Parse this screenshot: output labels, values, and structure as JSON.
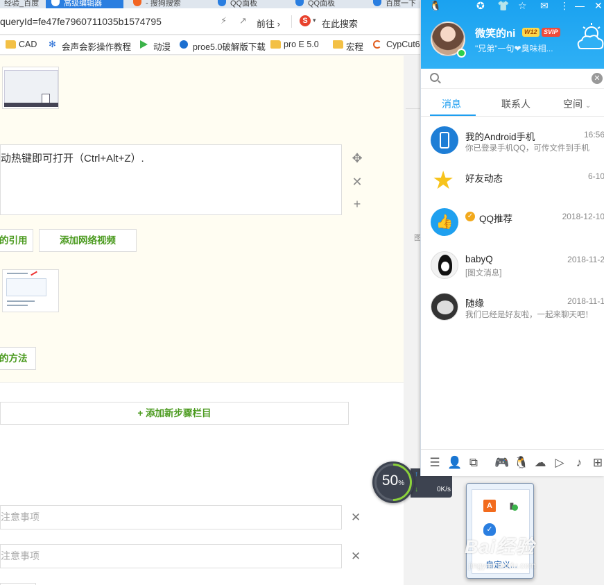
{
  "browser": {
    "tabs": [
      {
        "label": "经验_百度"
      },
      {
        "label": "高级编辑器"
      },
      {
        "label": "- 搜狗搜索"
      },
      {
        "label": "QQ面板"
      },
      {
        "label": "QQ面板"
      },
      {
        "label": "百度一下"
      }
    ],
    "url": "queryId=fe47fe7960711035b1574795",
    "go_label": "前往",
    "search_label": "在此搜索",
    "bookmarks": [
      {
        "label": "CAD"
      },
      {
        "label": "会声会影操作教程"
      },
      {
        "label": "动漫"
      },
      {
        "label": "proe5.0破解版下载"
      },
      {
        "label": "pro E 5.0"
      },
      {
        "label": "宏程"
      },
      {
        "label": "CypCut6"
      }
    ]
  },
  "editor": {
    "step_text": "动热键即可打开（Ctrl+Alt+Z）.",
    "btn_link": "的引用",
    "btn_video": "添加网络视频",
    "btn_method": "的方法",
    "add_step": "+ 添加新步骤栏目",
    "note_placeholder_1": "注意事项",
    "note_placeholder_2": "注意事项",
    "gutter_char": "图"
  },
  "speed": {
    "percent": "50",
    "percent_unit": "%",
    "up": "0K/s",
    "down": "0K/s"
  },
  "tray": {
    "customize": "自定义..."
  },
  "watermark": {
    "brand": "Bai经验",
    "url": "jingyan.baidu.com"
  },
  "qq": {
    "nickname": "微笑的ni",
    "level_badge": "W12",
    "vip_badge": "SVIP",
    "signature": "\"兄弟\"一句❤臭味相...",
    "tabs": {
      "messages": "消息",
      "contacts": "联系人",
      "zone": "空间"
    },
    "conversations": [
      {
        "name": "我的Android手机",
        "time": "16:56",
        "message": "你已登录手机QQ，可传文件到手机"
      },
      {
        "name": "好友动态",
        "time": "6-10",
        "message": ""
      },
      {
        "name": "QQ推荐",
        "time": "2018-12-10",
        "message": ""
      },
      {
        "name": "babyQ",
        "time": "2018-11-2",
        "message": "[图文消息]"
      },
      {
        "name": "随缘",
        "time": "2018-11-1",
        "message": "我们已经是好友啦，一起来聊天吧！"
      }
    ],
    "colors": {
      "header": "#1aa2f0",
      "accent": "#1e9ef0"
    }
  }
}
